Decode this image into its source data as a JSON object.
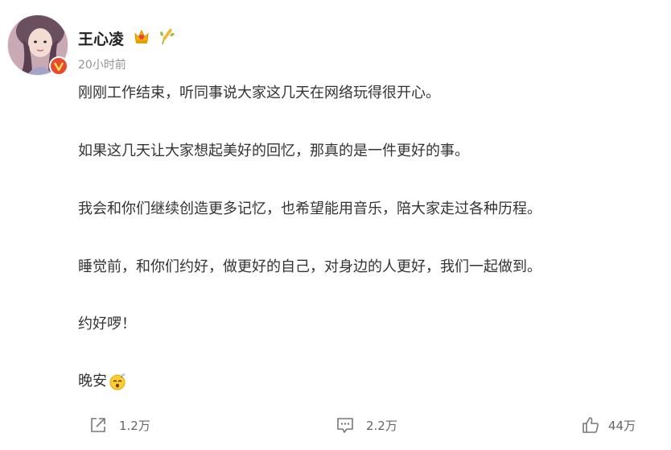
{
  "author": {
    "name": "王心凌",
    "avatar_icon": "avatar-photo",
    "verified_badge_icon": "verified-v-icon",
    "badges": [
      "crown-icon",
      "wheat-icon"
    ]
  },
  "post": {
    "timestamp": "20小时前",
    "paragraphs": [
      "刚刚工作结束，听同事说大家这几天在网络玩得很开心。",
      "如果这几天让大家想起美好的回忆，那真的是一件更好的事。",
      "我会和你们继续创造更多记忆，也希望能用音乐，陪大家走过各种历程。",
      "睡觉前，和你们约好，做更好的自己，对身边的人更好，我们一起做到。",
      "约好啰！",
      "晚安"
    ],
    "closing_emoji": "sleepy-face-emoji"
  },
  "actions": {
    "share_count": "1.2万",
    "comment_count": "2.2万",
    "like_count": "44万"
  },
  "colors": {
    "verified": "#e74a2f",
    "crown": "#f5b400",
    "text": "#333333",
    "muted": "#939393"
  }
}
